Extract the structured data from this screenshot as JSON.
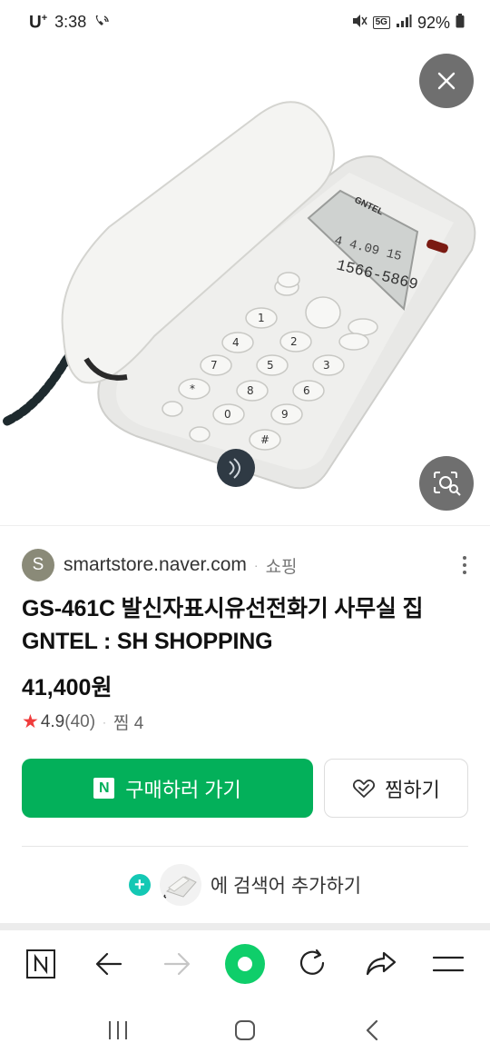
{
  "status_bar": {
    "carrier": "U",
    "carrier_sup": "+",
    "time": "3:38",
    "network": "5G",
    "battery": "92%"
  },
  "image": {
    "alt_icon": "phone-product-image",
    "display_lines": [
      "4  4.09  15",
      "1566-5869"
    ],
    "brand": "GNTEL"
  },
  "source": {
    "avatar_letter": "S",
    "domain": "smartstore.naver.com",
    "separator": "·",
    "category": "쇼핑"
  },
  "product": {
    "title_line1": "GS-461C 발신자표시유선전화기 사무실 집",
    "title_line2": "GNTEL : SH SHOPPING",
    "price": "41,400원",
    "rating": "4.9",
    "review_count": "(40)",
    "separator": "·",
    "zzim": "찜 4"
  },
  "buttons": {
    "buy_label": "구매하러 가기",
    "buy_icon_letter": "N",
    "wish_label": "찜하기"
  },
  "search_add": {
    "label": "에 검색어 추가하기"
  },
  "colors": {
    "primary_green": "#03b05a",
    "star_red": "#f03c3c",
    "teal": "#14c8b4",
    "overlay_gray": "#6f6f6f"
  }
}
